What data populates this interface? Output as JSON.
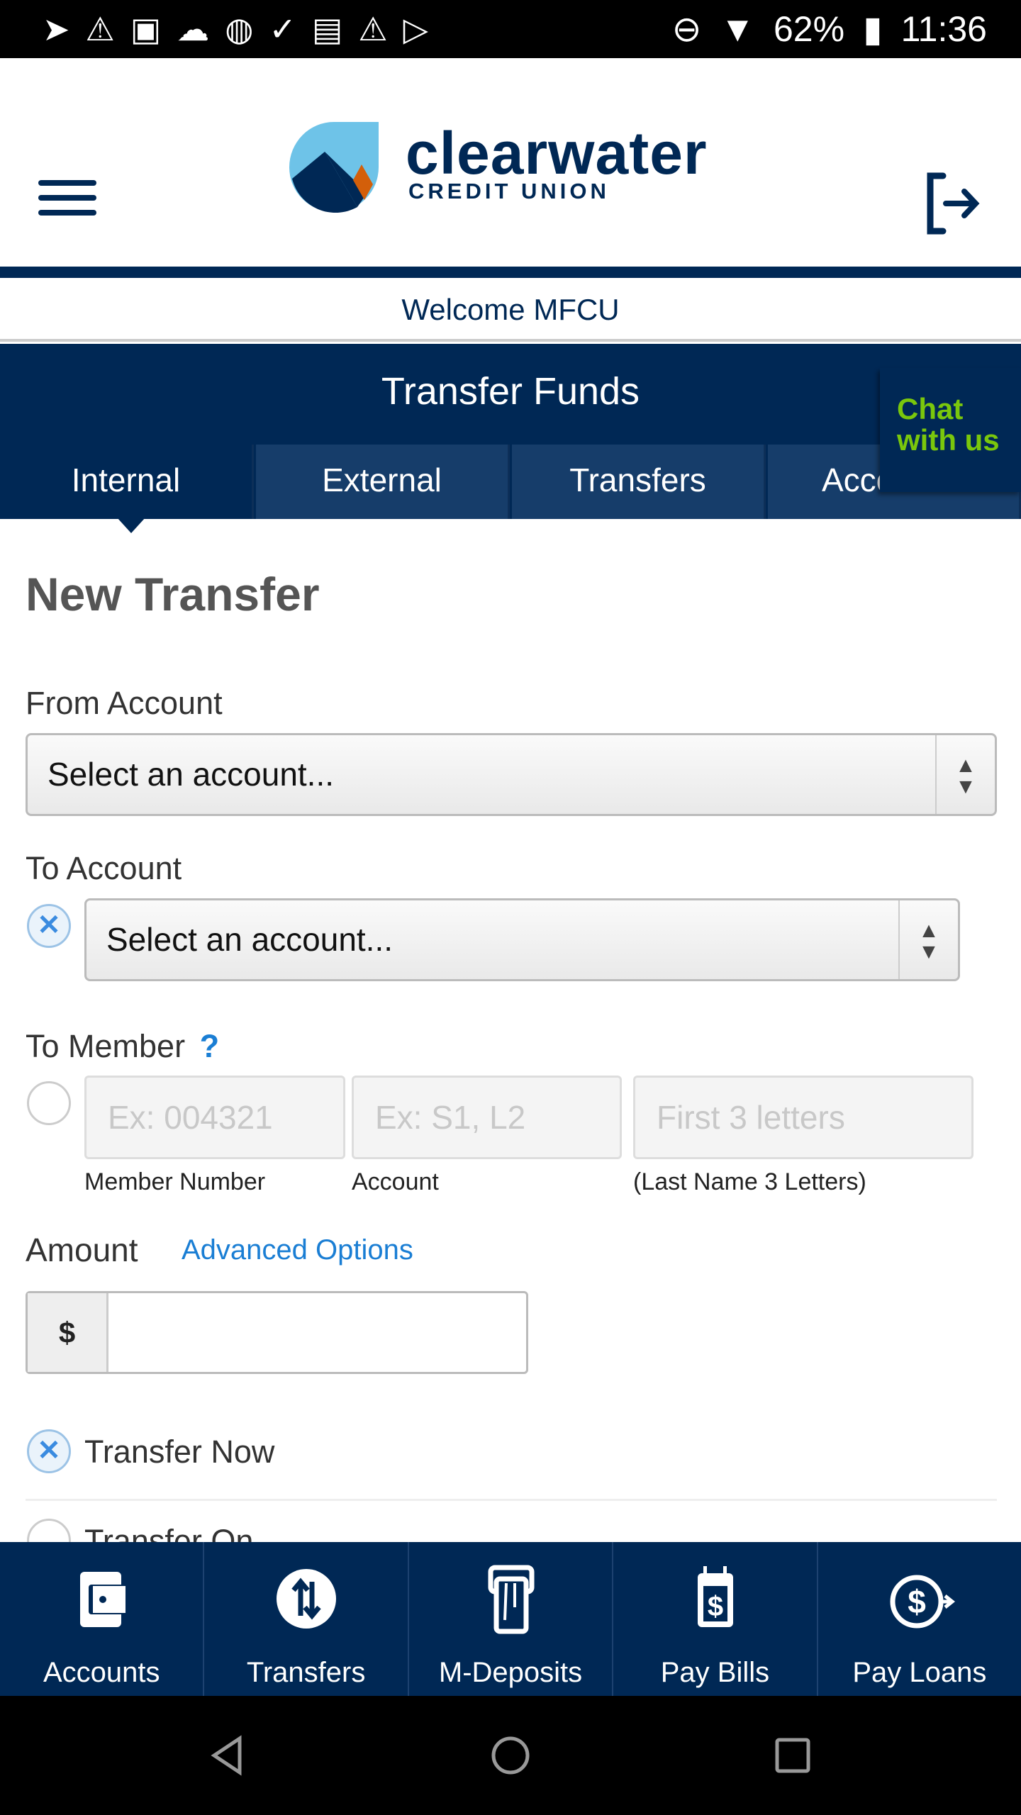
{
  "status_bar": {
    "battery": "62%",
    "time": "11:36"
  },
  "header": {
    "brand": "clearwater",
    "brand_sub": "CREDIT UNION",
    "menu_icon": "hamburger-icon",
    "logout_icon": "logout-icon"
  },
  "welcome": "Welcome MFCU",
  "transfer": {
    "title": "Transfer Funds",
    "tabs": [
      {
        "label": "Internal",
        "active": true
      },
      {
        "label": "External"
      },
      {
        "label": "Transfers"
      },
      {
        "label": "Accounts"
      }
    ]
  },
  "chat": {
    "label_line1": "Chat",
    "label_line2": "with us"
  },
  "form": {
    "heading": "New Transfer",
    "from_label": "From Account",
    "from_value": "Select an account...",
    "to_label": "To Account",
    "to_value": "Select an account...",
    "member_label": "To Member",
    "member_help": "?",
    "member_number_placeholder": "Ex: 004321",
    "member_number_label": "Member Number",
    "account_placeholder": "Ex: S1, L2",
    "account_label": "Account",
    "letters_placeholder": "First  3  letters",
    "letters_label": "(Last Name  3  Letters)",
    "amount_label": "Amount",
    "advanced_options": "Advanced Options",
    "currency": "$",
    "transfer_now": "Transfer Now",
    "transfer_on": "Transfer On"
  },
  "bottom_nav": [
    {
      "label": "Accounts",
      "icon": "wallet-icon"
    },
    {
      "label": "Transfers",
      "icon": "transfer-arrows-icon"
    },
    {
      "label": "M-Deposits",
      "icon": "check-deposit-icon"
    },
    {
      "label": "Pay Bills",
      "icon": "calendar-dollar-icon"
    },
    {
      "label": "Pay Loans",
      "icon": "dollar-arrow-icon"
    }
  ],
  "colors": {
    "navy": "#002855",
    "chat_green": "#7ac70c",
    "link": "#1a7ed4",
    "logo_sky": "#6ec3e8",
    "logo_orange": "#d35f0a"
  }
}
